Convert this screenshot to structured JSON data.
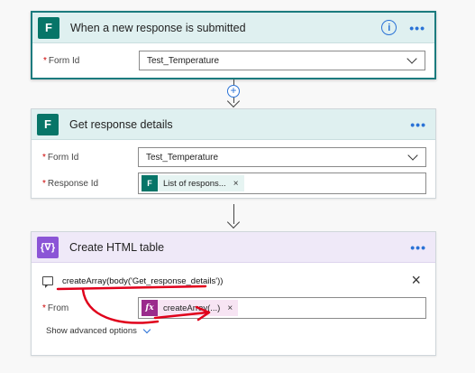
{
  "cards": {
    "trigger": {
      "title": "When a new response is submitted",
      "form_id_label": "Form Id",
      "form_id_value": "Test_Temperature"
    },
    "get_details": {
      "title": "Get response details",
      "form_id_label": "Form Id",
      "form_id_value": "Test_Temperature",
      "response_id_label": "Response Id",
      "response_id_token": "List of respons...",
      "token_remove": "×"
    },
    "html_table": {
      "title": "Create HTML table",
      "expression": "createArray(body('Get_response_details'))",
      "from_label": "From",
      "from_token": "createArray(...)",
      "token_remove": "×",
      "close": "×",
      "advanced_options": "Show advanced options"
    }
  },
  "icons": {
    "info": "i",
    "more": "•••",
    "plus": "+",
    "fx": "fx",
    "required": "*"
  },
  "colors": {
    "forms_brand": "#077568",
    "operation_brand": "#8b55d6",
    "annotation": "#e0001b",
    "link_blue": "#2a72d6"
  }
}
